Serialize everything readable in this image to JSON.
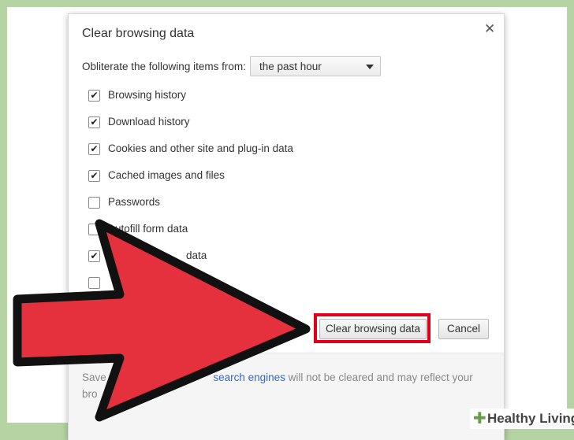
{
  "dialog": {
    "title": "Clear browsing data",
    "close_glyph": "✕",
    "obliterate_label": "Obliterate the following items from:",
    "time_range": "the past hour",
    "items": [
      {
        "label": "Browsing history",
        "checked": true
      },
      {
        "label": "Download history",
        "checked": true
      },
      {
        "label": "Cookies and other site and plug-in data",
        "checked": true
      },
      {
        "label": "Cached images and files",
        "checked": true
      },
      {
        "label": "Passwords",
        "checked": false
      },
      {
        "label": "Autofill form data",
        "checked": false
      },
      {
        "label": "data",
        "checked": true
      },
      {
        "label": "",
        "checked": false
      }
    ],
    "clear_button": "Clear browsing data",
    "cancel_button": "Cancel",
    "footer": {
      "text_before": "Save",
      "link": "search engines",
      "text_after": "will not be cleared and may reflect your",
      "text_line2": "bro"
    }
  },
  "watermark": {
    "brand": "Healthy Living",
    "brand_icon": "plus-icon"
  },
  "colors": {
    "arrow_fill": "#e5303e",
    "arrow_outline": "#111111",
    "highlight": "#e00018",
    "background": "#b5d3a3",
    "link": "#3367d6"
  }
}
